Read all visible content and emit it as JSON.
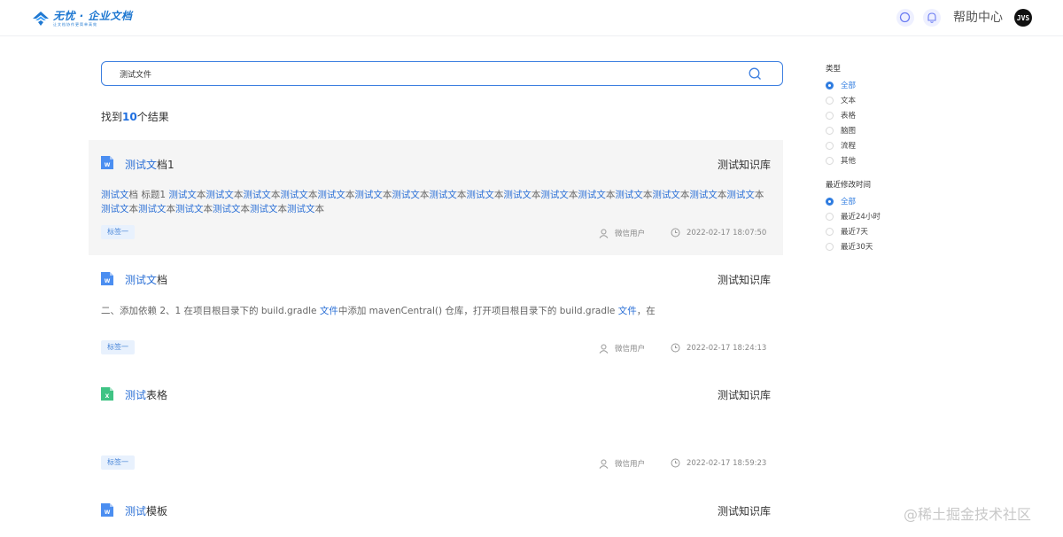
{
  "header": {
    "logo_title": "无忧 · 企业文档",
    "logo_subtitle": "让文档协作更简单高效",
    "help_label": "帮助中心",
    "avatar_text": "JVS",
    "search_icon": "search-icon",
    "bell_icon": "bell-icon"
  },
  "search": {
    "value": "测试文件"
  },
  "results_summary": {
    "prefix": "找到",
    "count": "10",
    "suffix": "个结果"
  },
  "results": [
    {
      "type": "word",
      "title_highlight": "测试文",
      "title_rest": "档1",
      "library": "测试知识库",
      "snippet_html": "<span class=\"hl\">测试文</span>档 标题1 <span class=\"hl\">测试文</span>本<span class=\"hl\">测试文</span>本<span class=\"hl\">测试文</span>本<span class=\"hl\">测试文</span>本<span class=\"hl\">测试文</span>本<span class=\"hl\">测试文</span>本<span class=\"hl\">测试文</span>本<span class=\"hl\">测试文</span>本<span class=\"hl\">测试文</span>本<span class=\"hl\">测试文</span>本<span class=\"hl\">测试文</span>本<span class=\"hl\">测试文</span>本<span class=\"hl\">测试文</span>本<span class=\"hl\">测试文</span>本<span class=\"hl\">测试文</span>本<span class=\"hl\">测试文</span>本<span class=\"hl\">测试文</span>本<span class=\"hl\">测试文</span>本<span class=\"hl\">测试文</span>本<span class=\"hl\">测试文</span>本<span class=\"hl\">测试文</span>本<span class=\"hl\">测试文</span>本",
      "tag": "标签一",
      "author": "微信用户",
      "time": "2022-02-17 18:07:50"
    },
    {
      "type": "word",
      "title_highlight": "测试文",
      "title_rest": "档",
      "library": "测试知识库",
      "snippet_html": "二、添加依赖 2、1 在项目根目录下的 build.gradle <span class=\"hl\">文件</span>中添加 mavenCentral() 仓库，打开项目根目录下的 build.gradle <span class=\"hl\">文件</span>，在",
      "tag": "标签一",
      "author": "微信用户",
      "time": "2022-02-17 18:24:13"
    },
    {
      "type": "excel",
      "title_highlight": "测试",
      "title_rest": "表格",
      "library": "测试知识库",
      "snippet_html": "",
      "tag": "标签一",
      "author": "微信用户",
      "time": "2022-02-17 18:59:23"
    },
    {
      "type": "word",
      "title_highlight": "测试",
      "title_rest": "模板",
      "library": "测试知识库"
    }
  ],
  "filters": {
    "type_title": "类型",
    "type_options": [
      "全部",
      "文本",
      "表格",
      "脑图",
      "流程",
      "其他"
    ],
    "time_title": "最近修改时间",
    "time_options": [
      "全部",
      "最近24小时",
      "最近7天",
      "最近30天"
    ]
  },
  "colors": {
    "accent": "#2f7ce0",
    "word_icon": "#4b8ef1",
    "excel_icon": "#3fc384"
  },
  "watermark": "@稀土掘金技术社区"
}
